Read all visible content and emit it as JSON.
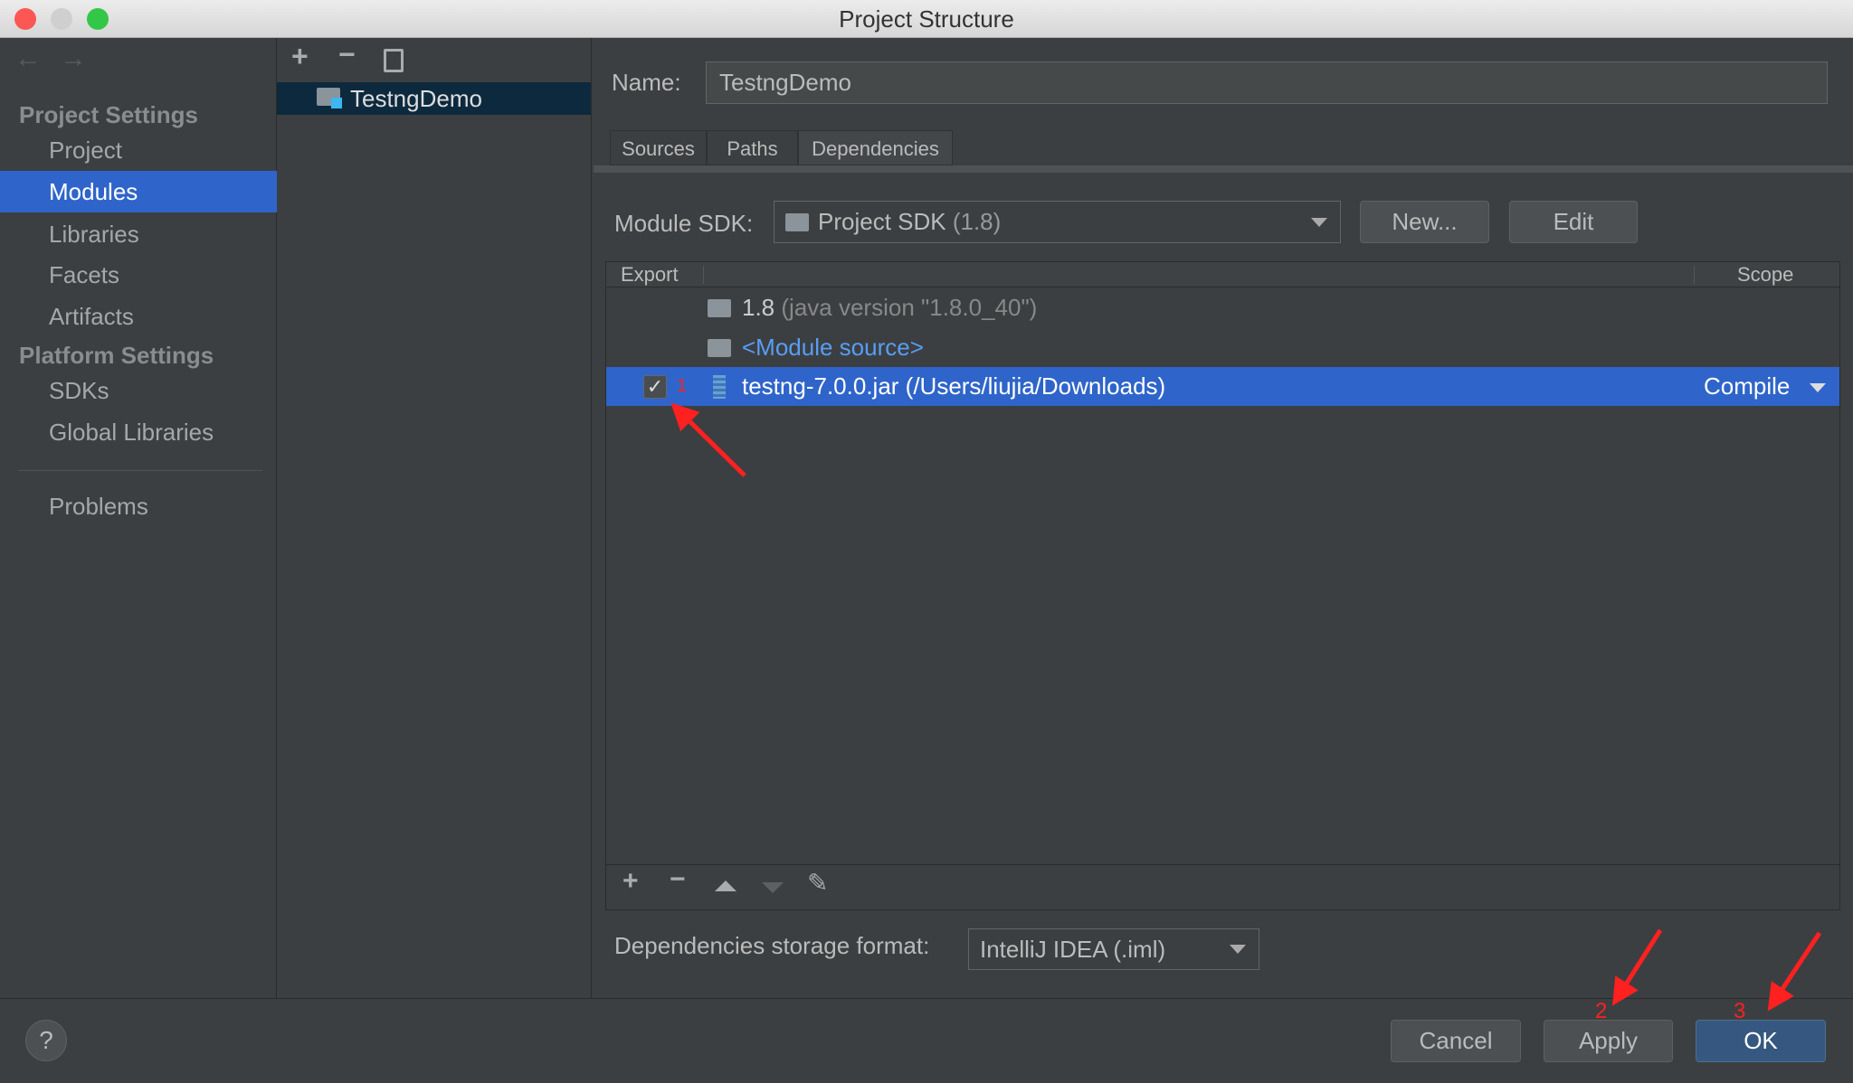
{
  "window": {
    "title": "Project Structure"
  },
  "sidebar": {
    "sections": [
      {
        "title": "Project Settings",
        "items": [
          {
            "label": "Project"
          },
          {
            "label": "Modules",
            "selected": true
          },
          {
            "label": "Libraries"
          },
          {
            "label": "Facets"
          },
          {
            "label": "Artifacts"
          }
        ]
      },
      {
        "title": "Platform Settings",
        "items": [
          {
            "label": "SDKs"
          },
          {
            "label": "Global Libraries"
          }
        ]
      }
    ],
    "problems": "Problems"
  },
  "module_tree": {
    "items": [
      {
        "label": "TestngDemo",
        "icon": "module-folder-icon"
      }
    ]
  },
  "name_field": {
    "label": "Name:",
    "value": "TestngDemo"
  },
  "tabs": [
    {
      "label": "Sources"
    },
    {
      "label": "Paths"
    },
    {
      "label": "Dependencies",
      "active": true
    }
  ],
  "sdk": {
    "label": "Module SDK:",
    "value": "Project SDK",
    "version": "(1.8)",
    "new_button": "New...",
    "edit_button": "Edit"
  },
  "table": {
    "headers": {
      "export": "Export",
      "scope": "Scope"
    },
    "rows": [
      {
        "name": "1.8",
        "detail": "(java version \"1.8.0_40\")",
        "icon": "jdk-folder-icon"
      },
      {
        "name": "<Module source>",
        "icon": "source-folder-icon"
      },
      {
        "name": "testng-7.0.0.jar (/Users/liujia/Downloads)",
        "icon": "jar-icon",
        "exported": true,
        "scope": "Compile",
        "selected": true
      }
    ]
  },
  "storage": {
    "label": "Dependencies storage format:",
    "value": "IntelliJ IDEA (.iml)"
  },
  "footer": {
    "help": "?",
    "cancel": "Cancel",
    "apply": "Apply",
    "ok": "OK"
  },
  "annotations": {
    "step1": "1",
    "step2": "2",
    "step3": "3",
    "color": "#ff2020"
  },
  "colors": {
    "selection": "#2f65ca",
    "background": "#3c3f41",
    "ok_button": "#365880"
  }
}
